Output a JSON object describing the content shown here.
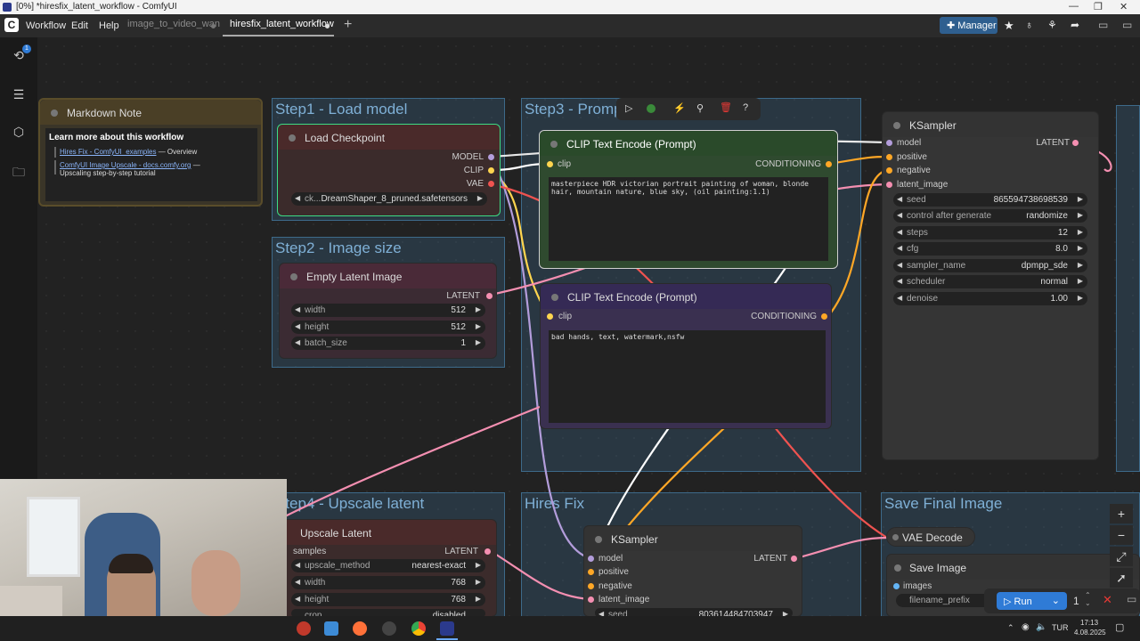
{
  "window": {
    "title": "[0%] *hiresfix_latent_workflow - ComfyUI"
  },
  "menu": {
    "workflow": "Workflow",
    "edit": "Edit",
    "help": "Help"
  },
  "tabs": [
    {
      "label": "image_to_video_wan"
    },
    {
      "label": "hiresfix_latent_workflow"
    }
  ],
  "toolbar": {
    "manager": "Manager",
    "queue_badge": "1"
  },
  "groups": {
    "step1": "Step1 - Load model",
    "step2": "Step2 - Image size",
    "step3": "Step3 - Prompt",
    "step4": "Step4 - Upscale latent",
    "hires": "Hires Fix",
    "save": "Save Final Image"
  },
  "note": {
    "title": "Markdown Note",
    "heading": "Learn more about this workflow",
    "link1": "Hires Fix - ComfyUI_examples",
    "link1_suffix": "— Overview",
    "link2": "ComfyUI Image Upscale - docs.comfy.org",
    "link2_suffix": "—",
    "link2_desc": "Upscaling step-by-step tutorial"
  },
  "checkpoint": {
    "title": "Load Checkpoint",
    "out_model": "MODEL",
    "out_clip": "CLIP",
    "out_vae": "VAE",
    "ckpt_label": "ck...",
    "ckpt_value": "DreamShaper_8_pruned.safetensors"
  },
  "latent": {
    "title": "Empty Latent Image",
    "out": "LATENT",
    "width_label": "width",
    "width": "512",
    "height_label": "height",
    "height": "512",
    "batch_label": "batch_size",
    "batch": "1"
  },
  "clip_pos": {
    "title": "CLIP Text Encode (Prompt)",
    "in_clip": "clip",
    "out": "CONDITIONING",
    "text": "masterpiece HDR victorian portrait painting of woman, blonde hair, mountain nature, blue sky, (oil painting:1.1)"
  },
  "clip_neg": {
    "title": "CLIP Text Encode (Prompt)",
    "in_clip": "clip",
    "out": "CONDITIONING",
    "text": "bad hands, text, watermark,nsfw"
  },
  "ksampler1": {
    "title": "KSampler",
    "in_model": "model",
    "in_positive": "positive",
    "in_negative": "negative",
    "in_latent": "latent_image",
    "out": "LATENT",
    "rows": [
      {
        "label": "seed",
        "value": "865594738698539"
      },
      {
        "label": "control after generate",
        "value": "randomize"
      },
      {
        "label": "steps",
        "value": "12"
      },
      {
        "label": "cfg",
        "value": "8.0"
      },
      {
        "label": "sampler_name",
        "value": "dpmpp_sde"
      },
      {
        "label": "scheduler",
        "value": "normal"
      },
      {
        "label": "denoise",
        "value": "1.00"
      }
    ]
  },
  "upscale": {
    "title": "Upscale Latent",
    "in_samples": "samples",
    "out": "LATENT",
    "method_label": "upscale_method",
    "method": "nearest-exact",
    "width_label": "width",
    "width": "768",
    "height_label": "height",
    "height": "768",
    "crop_label": "crop",
    "crop": "disabled"
  },
  "ksampler2": {
    "title": "KSampler",
    "in_model": "model",
    "in_positive": "positive",
    "in_negative": "negative",
    "in_latent": "latent_image",
    "out": "LATENT",
    "seed_label": "seed",
    "seed": "803614484703947"
  },
  "vae_decode": {
    "title": "VAE Decode"
  },
  "save_image": {
    "title": "Save Image",
    "in_images": "images",
    "prefix_label": "filename_prefix"
  },
  "run": {
    "label": "Run",
    "count": "1"
  },
  "taskbar": {
    "lang": "TUR",
    "time": "17:13",
    "date": "4.08.2025"
  },
  "colors": {
    "model": "#b39ddb",
    "clip": "#ffd54f",
    "vae": "#ef5350",
    "latent": "#f48fb1",
    "conditioning": "#ffa726",
    "image": "#64b5f6",
    "accent": "#2f7bd6"
  }
}
